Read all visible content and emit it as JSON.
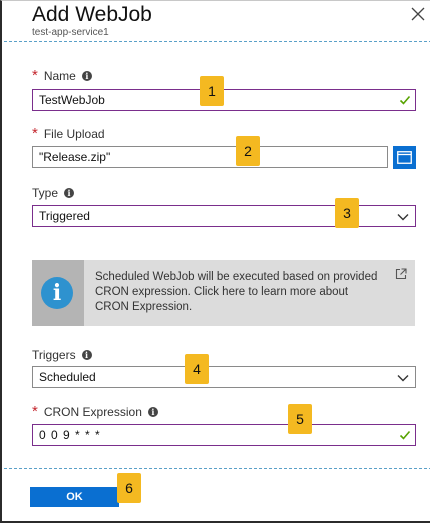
{
  "blade": {
    "title": "Add WebJob",
    "subtitle": "test-app-service1"
  },
  "form": {
    "name": {
      "label": "Name",
      "required": "*",
      "value": "TestWebJob"
    },
    "file_upload": {
      "label": "File Upload",
      "required": "*",
      "value": "\"Release.zip\""
    },
    "type": {
      "label": "Type",
      "value": "Triggered"
    },
    "info_message": "Scheduled WebJob will be executed based on provided CRON expression. Click here to learn more about CRON Expression.",
    "triggers": {
      "label": "Triggers",
      "value": "Scheduled"
    },
    "cron": {
      "label": "CRON Expression",
      "required": "*",
      "value": "0 0 9 * * *"
    }
  },
  "actions": {
    "ok_label": "OK"
  },
  "callouts": [
    "1",
    "2",
    "3",
    "4",
    "5",
    "6"
  ],
  "icons": {
    "info": "info-icon",
    "valid": "check-icon",
    "dropdown": "chevron-down-icon",
    "browse": "folder-icon",
    "external": "external-link-icon",
    "close": "close-icon"
  },
  "colors": {
    "accent": "#0a6fd1",
    "required": "#c4262e",
    "focus_border": "#7a2e8c",
    "valid_check": "#57a300",
    "callout": "#f4b921",
    "info_banner": "#dcdcdc"
  }
}
